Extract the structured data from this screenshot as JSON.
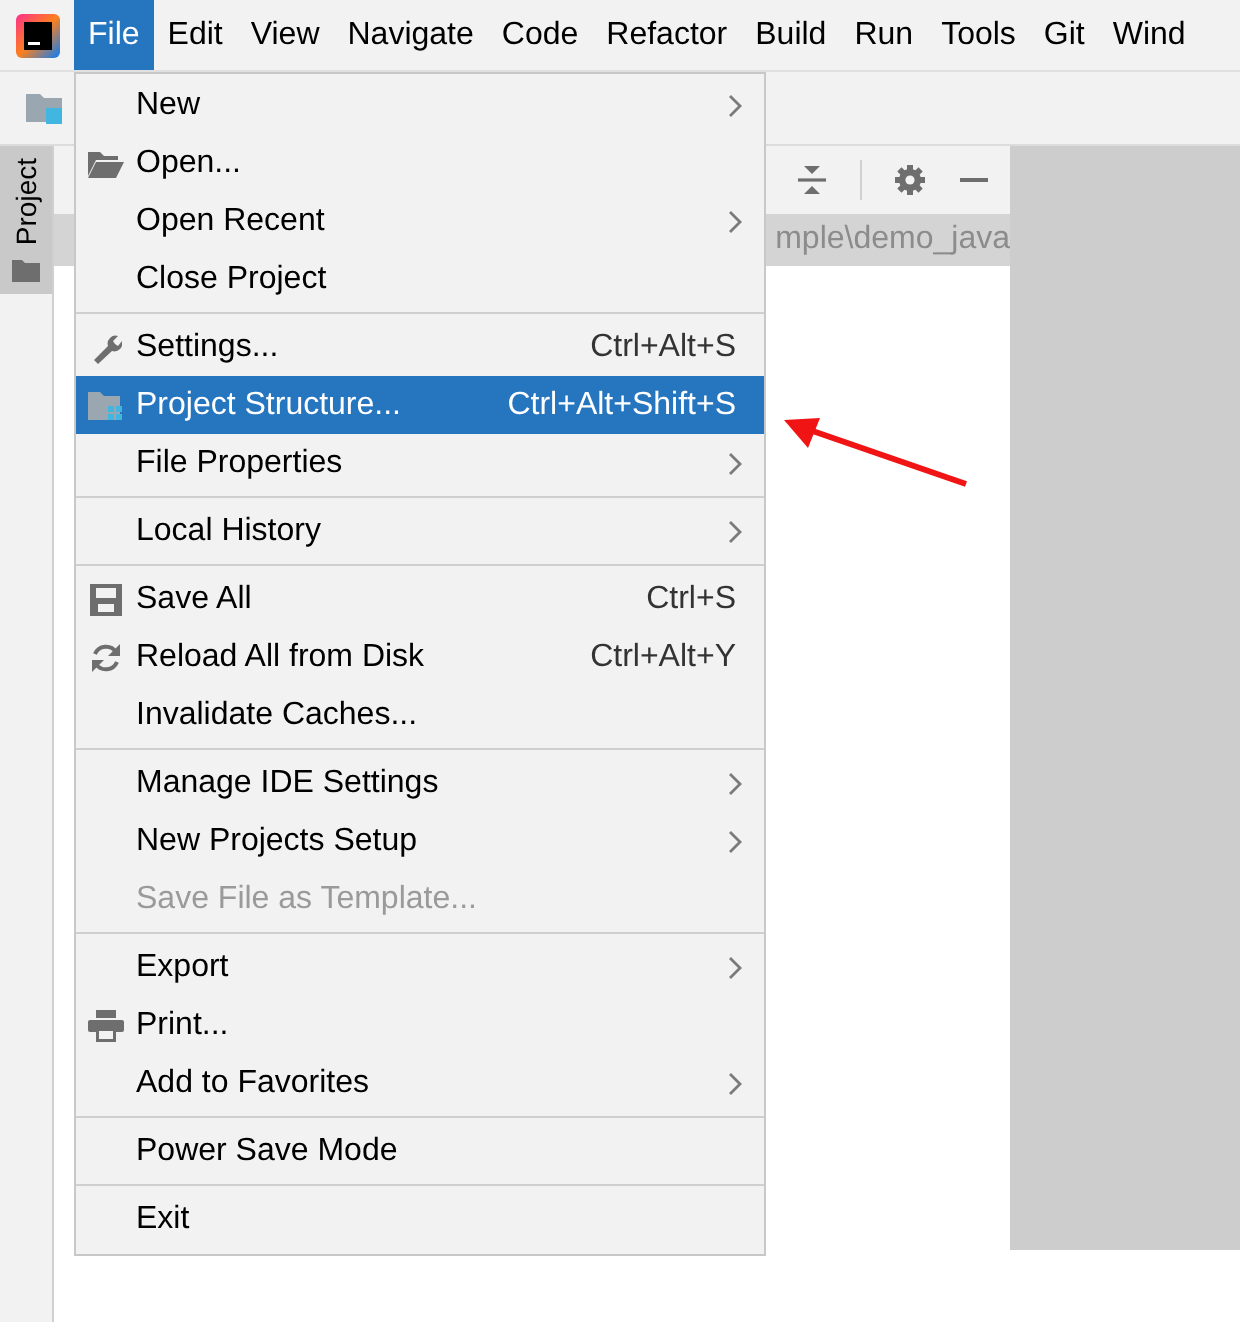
{
  "menu_bar": [
    {
      "label": "File",
      "selected": true
    },
    {
      "label": "Edit",
      "selected": false
    },
    {
      "label": "View",
      "selected": false
    },
    {
      "label": "Navigate",
      "selected": false
    },
    {
      "label": "Code",
      "selected": false
    },
    {
      "label": "Refactor",
      "selected": false
    },
    {
      "label": "Build",
      "selected": false
    },
    {
      "label": "Run",
      "selected": false
    },
    {
      "label": "Tools",
      "selected": false
    },
    {
      "label": "Git",
      "selected": false
    },
    {
      "label": "Wind",
      "selected": false
    }
  ],
  "tool_window_stripe": [
    {
      "label": "Project",
      "selected": true
    }
  ],
  "project_panel": {
    "path": "mple\\demo_java"
  },
  "file_menu": [
    {
      "kind": "item",
      "label": "New",
      "submenu": true,
      "selected": false,
      "disabled": false
    },
    {
      "kind": "item",
      "label": "Open...",
      "selected": false,
      "disabled": false
    },
    {
      "kind": "item",
      "label": "Open Recent",
      "submenu": true,
      "selected": false,
      "disabled": false
    },
    {
      "kind": "item",
      "label": "Close Project",
      "selected": false,
      "disabled": false
    },
    {
      "kind": "separator"
    },
    {
      "kind": "item",
      "label": "Settings...",
      "shortcut": "Ctrl+Alt+S",
      "selected": false,
      "disabled": false
    },
    {
      "kind": "item",
      "label": "Project Structure...",
      "shortcut": "Ctrl+Alt+Shift+S",
      "selected": true,
      "disabled": false
    },
    {
      "kind": "item",
      "label": "File Properties",
      "submenu": true,
      "selected": false,
      "disabled": false
    },
    {
      "kind": "separator"
    },
    {
      "kind": "item",
      "label": "Local History",
      "submenu": true,
      "selected": false,
      "disabled": false
    },
    {
      "kind": "separator"
    },
    {
      "kind": "item",
      "label": "Save All",
      "shortcut": "Ctrl+S",
      "selected": false,
      "disabled": false
    },
    {
      "kind": "item",
      "label": "Reload All from Disk",
      "shortcut": "Ctrl+Alt+Y",
      "selected": false,
      "disabled": false
    },
    {
      "kind": "item",
      "label": "Invalidate Caches...",
      "selected": false,
      "disabled": false
    },
    {
      "kind": "separator"
    },
    {
      "kind": "item",
      "label": "Manage IDE Settings",
      "submenu": true,
      "selected": false,
      "disabled": false
    },
    {
      "kind": "item",
      "label": "New Projects Setup",
      "submenu": true,
      "selected": false,
      "disabled": false
    },
    {
      "kind": "item",
      "label": "Save File as Template...",
      "selected": false,
      "disabled": true
    },
    {
      "kind": "separator"
    },
    {
      "kind": "item",
      "label": "Export",
      "submenu": true,
      "selected": false,
      "disabled": false
    },
    {
      "kind": "item",
      "label": "Print...",
      "selected": false,
      "disabled": false
    },
    {
      "kind": "item",
      "label": "Add to Favorites",
      "submenu": true,
      "selected": false,
      "disabled": false
    },
    {
      "kind": "separator"
    },
    {
      "kind": "item",
      "label": "Power Save Mode",
      "selected": false,
      "disabled": false
    },
    {
      "kind": "separator"
    },
    {
      "kind": "item",
      "label": "Exit",
      "selected": false,
      "disabled": false
    }
  ]
}
